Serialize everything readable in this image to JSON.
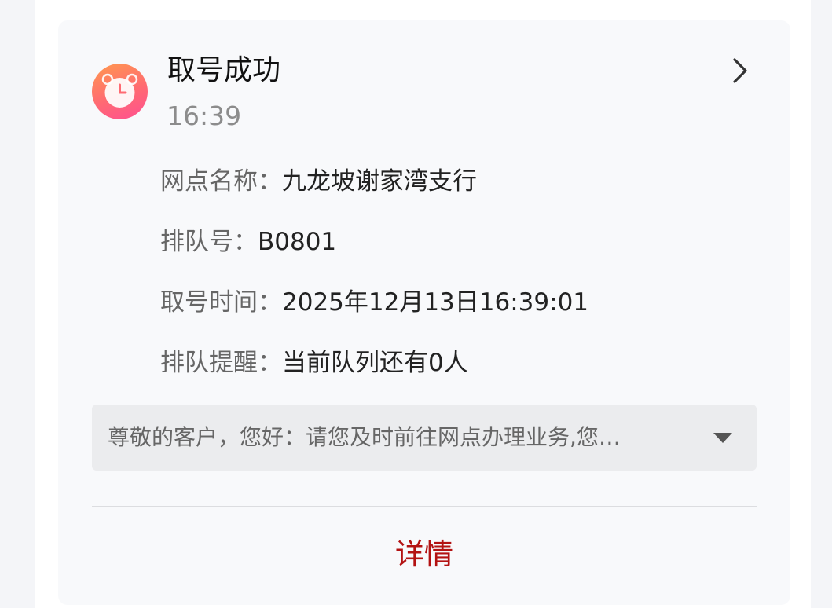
{
  "notification": {
    "title": "取号成功",
    "time": "16:39",
    "app_icon": "alarm-clock-icon",
    "open_icon": "chevron-right-icon",
    "icon_gradient": [
      "#ff9a4e",
      "#ff4f91"
    ]
  },
  "fields": [
    {
      "label": "网点名称：",
      "value": "九龙坡谢家湾支行"
    },
    {
      "label": "排队号：",
      "value": "B0801"
    },
    {
      "label": "取号时间：",
      "value": "2025年12月13日16:39:01"
    },
    {
      "label": "排队提醒：",
      "value": "当前队列还有0人"
    }
  ],
  "notice": {
    "text": "尊敬的客户，您好：请您及时前往网点办理业务,您…",
    "toggle_icon": "caret-down-icon"
  },
  "actions": {
    "detail_label": "详情",
    "accent_color": "#b31212"
  }
}
